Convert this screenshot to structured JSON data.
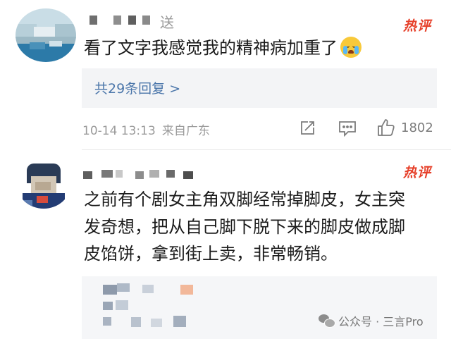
{
  "comments": [
    {
      "username_visible": "送",
      "hot_badge": "热评",
      "text": "看了文字我感觉我的精神病加重了",
      "emoji": "crying-face",
      "replies_label": "共29条回复 >",
      "timestamp": "10-14 13:13",
      "location": "来自广东",
      "like_count": "1802"
    },
    {
      "hot_badge": "热评",
      "text_lines": [
        "之前有个剧女主角双脚经常掉脚皮，女主突",
        "发奇想，把从自己脚下脱下来的脚皮做成脚",
        "皮馅饼，拿到街上卖，非常畅销。"
      ]
    }
  ],
  "watermark": {
    "text": "公众号 · 三言Pro",
    "icon": "wechat-icon"
  },
  "colors": {
    "hot": "#e6402a",
    "link": "#4b76aa",
    "muted": "#9b9b9b"
  }
}
